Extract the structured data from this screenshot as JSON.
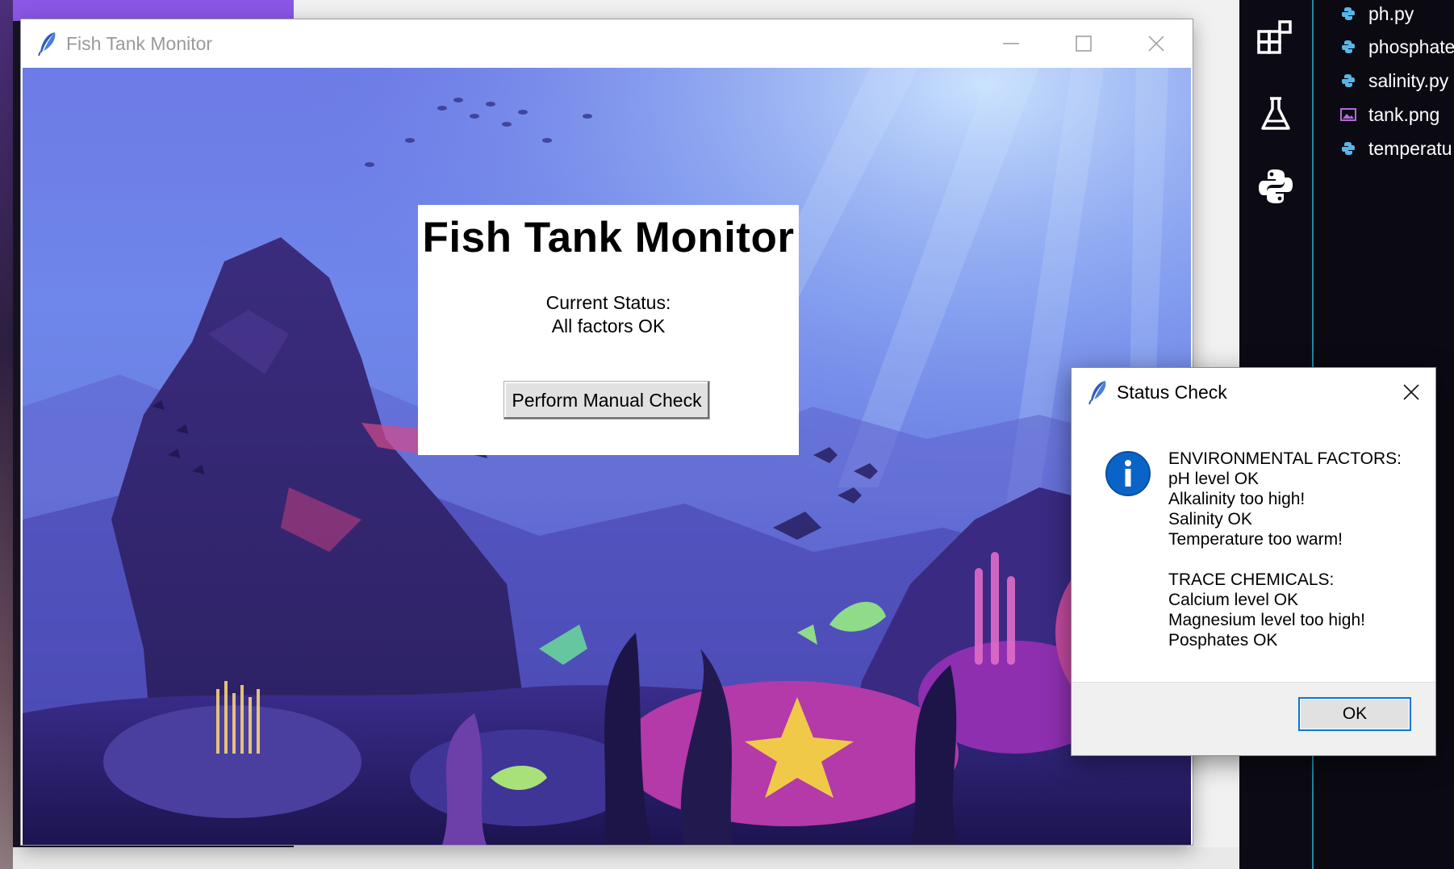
{
  "main_window": {
    "title": "Fish Tank Monitor",
    "card": {
      "heading": "Fish Tank Monitor",
      "status_label": "Current Status:",
      "status_value": "All factors OK",
      "button_label": "Perform Manual Check"
    }
  },
  "dialog": {
    "title": "Status Check",
    "message_lines": [
      "ENVIRONMENTAL FACTORS:",
      "pH level OK",
      "Alkalinity too high!",
      "Salinity OK",
      "Temperature too warm!",
      "",
      "TRACE CHEMICALS:",
      "Calcium level OK",
      "Magnesium level too high!",
      "Posphates OK"
    ],
    "ok_label": "OK"
  },
  "editor": {
    "activity_icons": [
      "extensions-icon",
      "testing-flask-icon",
      "python-icon"
    ],
    "files": [
      {
        "name": "ph.py",
        "icon": "python-file-icon"
      },
      {
        "name": "phosphate",
        "icon": "python-file-icon"
      },
      {
        "name": "salinity.py",
        "icon": "python-file-icon"
      },
      {
        "name": "tank.png",
        "icon": "image-file-icon"
      },
      {
        "name": "temperatu",
        "icon": "python-file-icon"
      }
    ]
  },
  "colors": {
    "dialog_ok_border": "#0078d7",
    "info_icon": "#0a64c8",
    "editor_accent": "#1a8aa0"
  }
}
